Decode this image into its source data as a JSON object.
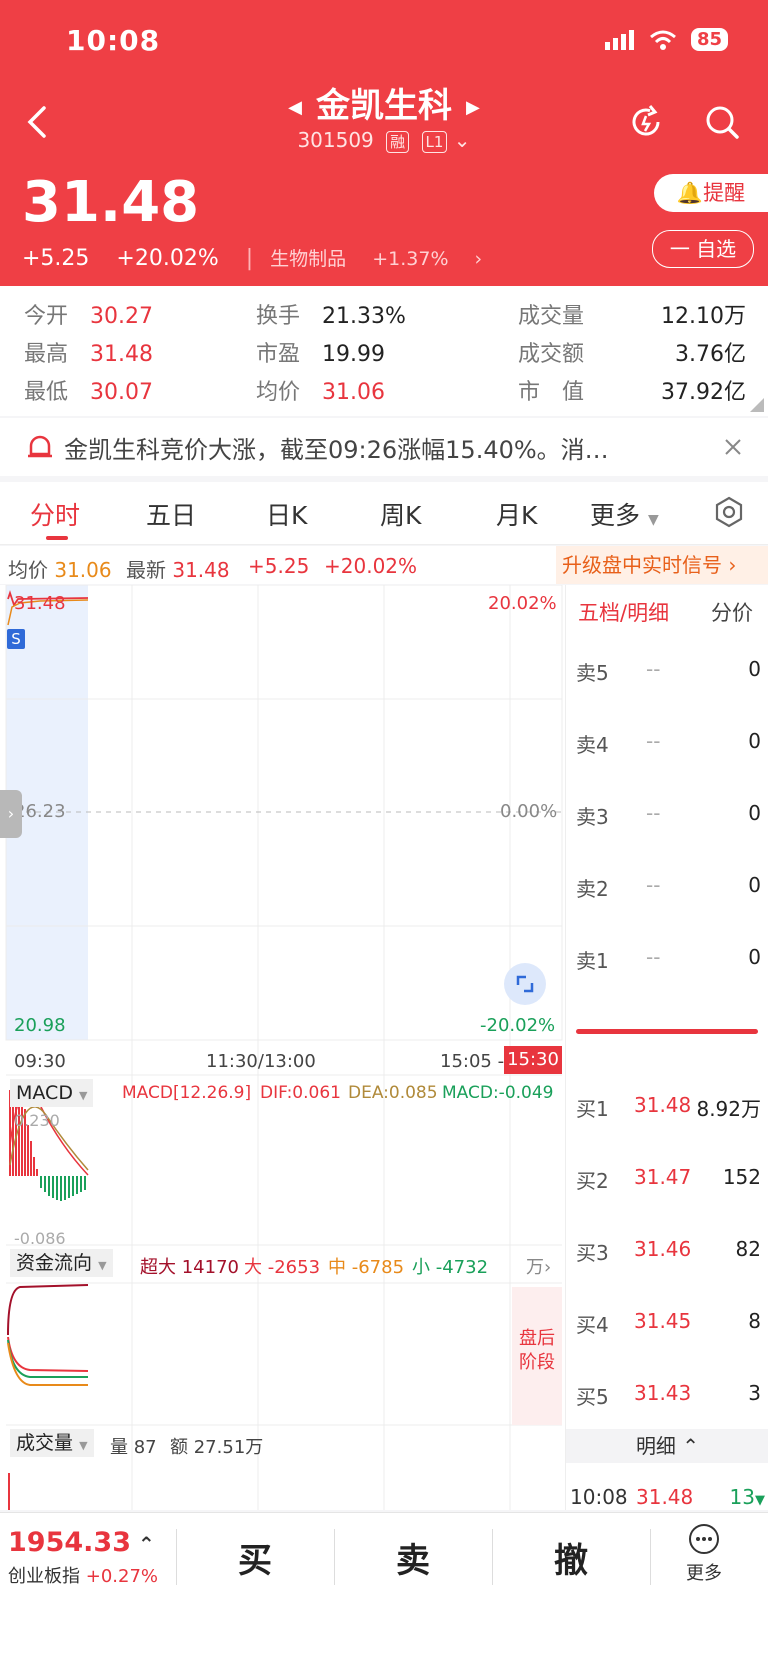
{
  "status_bar": {
    "time": "10:08",
    "battery": "85"
  },
  "header": {
    "stock_name": "金凯生科",
    "code": "301509",
    "tag_margin": "融",
    "tag_level": "L1",
    "price": "31.48",
    "change": "+5.25",
    "change_pct": "+20.02%",
    "sector": "生物制品",
    "sector_pct": "+1.37%",
    "alert_label": "提醒",
    "watch_label": "一 自选"
  },
  "stats": [
    {
      "label": "今开",
      "value": "30.27"
    },
    {
      "label": "最高",
      "value": "31.48"
    },
    {
      "label": "最低",
      "value": "30.07"
    },
    {
      "label": "换手",
      "value": "21.33%"
    },
    {
      "label": "市盈",
      "value": "19.99"
    },
    {
      "label": "均价",
      "value": "31.06"
    },
    {
      "label": "成交量",
      "value": "12.10万"
    },
    {
      "label": "成交额",
      "value": "3.76亿"
    },
    {
      "label": "市　值",
      "value": "37.92亿"
    }
  ],
  "news": {
    "text": "金凯生科竞价大涨，截至09:26涨幅15.40%。消…"
  },
  "tabs": [
    "分时",
    "五日",
    "日K",
    "周K",
    "月K",
    "更多"
  ],
  "info_bar": {
    "avg_label": "均价",
    "avg_value": "31.06",
    "latest_label": "最新",
    "latest_value": "31.48",
    "change": "+5.25",
    "change_pct": "+20.02%",
    "upgrade": "升级盘中实时信号"
  },
  "chart": {
    "price_high": "31.48",
    "pct_high": "20.02%",
    "price_mid": "26.23",
    "pct_mid": "0.00%",
    "price_low": "20.98",
    "pct_low": "-20.02%",
    "time_start": "09:30",
    "time_mid": "11:30/13:00",
    "time_end": "15:05 -",
    "time_now": "15:30",
    "s_marker": "S"
  },
  "macd": {
    "label": "MACD",
    "params": "MACD[12.26.9]",
    "dif": "DIF:0.061",
    "dea": "DEA:0.085",
    "macd": "MACD:-0.049",
    "top": "0.230",
    "bottom": "-0.086"
  },
  "fund_flow": {
    "label": "资金流向",
    "xl_label": "超大",
    "xl": "14170",
    "l_label": "大",
    "l": "-2653",
    "m_label": "中",
    "m": "-6785",
    "s_label": "小",
    "s": "-4732",
    "unit": "万",
    "after_hours_1": "盘后",
    "after_hours_2": "阶段"
  },
  "volume": {
    "label": "成交量",
    "vol_label": "量",
    "vol": "87",
    "amt_label": "额",
    "amt": "27.51万"
  },
  "order_book": {
    "title": "五档/明细",
    "tab2": "分价",
    "asks": [
      {
        "label": "卖5",
        "price": "--",
        "vol": "0"
      },
      {
        "label": "卖4",
        "price": "--",
        "vol": "0"
      },
      {
        "label": "卖3",
        "price": "--",
        "vol": "0"
      },
      {
        "label": "卖2",
        "price": "--",
        "vol": "0"
      },
      {
        "label": "卖1",
        "price": "--",
        "vol": "0"
      }
    ],
    "bids": [
      {
        "label": "买1",
        "price": "31.48",
        "vol": "8.92万"
      },
      {
        "label": "买2",
        "price": "31.47",
        "vol": "152"
      },
      {
        "label": "买3",
        "price": "31.46",
        "vol": "82"
      },
      {
        "label": "买4",
        "price": "31.45",
        "vol": "8"
      },
      {
        "label": "买5",
        "price": "31.43",
        "vol": "3"
      }
    ],
    "detail_label": "明细",
    "detail_time": "10:08",
    "detail_price": "31.48",
    "detail_vol": "13"
  },
  "bottom_bar": {
    "index_value": "1954.33",
    "index_name": "创业板指",
    "index_pct": "+0.27%",
    "buy": "买",
    "sell": "卖",
    "cancel": "撤",
    "more": "更多"
  },
  "colors": {
    "header_bg": "#ef3f45",
    "up": "#e8353e",
    "down": "#1aa05a"
  }
}
